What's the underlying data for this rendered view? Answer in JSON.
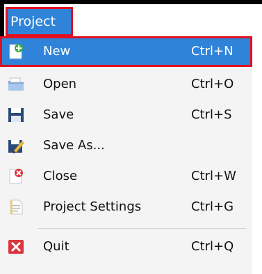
{
  "menu": {
    "title": "Project",
    "items": [
      {
        "label": "New",
        "shortcut": "Ctrl+N",
        "icon": "new-project-icon"
      },
      {
        "label": "Open",
        "shortcut": "Ctrl+O",
        "icon": "open-folder-icon"
      },
      {
        "label": "Save",
        "shortcut": "Ctrl+S",
        "icon": "save-disk-icon"
      },
      {
        "label": "Save As...",
        "shortcut": "",
        "icon": "save-as-icon"
      },
      {
        "label": "Close",
        "shortcut": "Ctrl+W",
        "icon": "close-project-icon"
      },
      {
        "label": "Project Settings",
        "shortcut": "Ctrl+G",
        "icon": "settings-document-icon"
      },
      {
        "label": "Quit",
        "shortcut": "Ctrl+Q",
        "icon": "quit-icon"
      }
    ],
    "selected_label": "New"
  },
  "colors": {
    "highlight": "#2f84d9",
    "outline": "#e01020"
  }
}
